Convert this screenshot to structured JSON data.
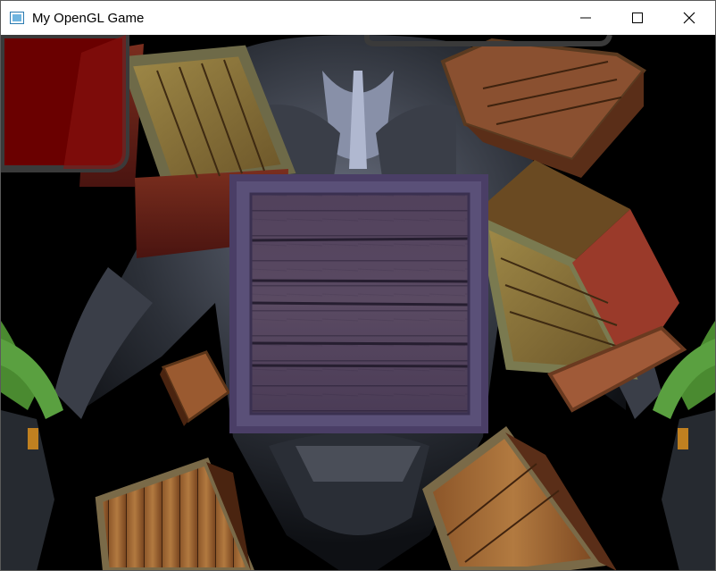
{
  "window": {
    "title": "My OpenGL Game",
    "controls": {
      "minimize": "minimize-icon",
      "maximize": "maximize-icon",
      "close": "close-icon"
    }
  },
  "scene": {
    "background_color": "#000000",
    "crate_colors": {
      "wood_light": "#b07a3a",
      "wood_dark": "#5e3418",
      "frame": "#8a8a5a",
      "center_tint": "#5a4a7a"
    },
    "overlay_colors": {
      "red_panel": "#6a0000",
      "panel_border": "#3a3a3a"
    }
  }
}
